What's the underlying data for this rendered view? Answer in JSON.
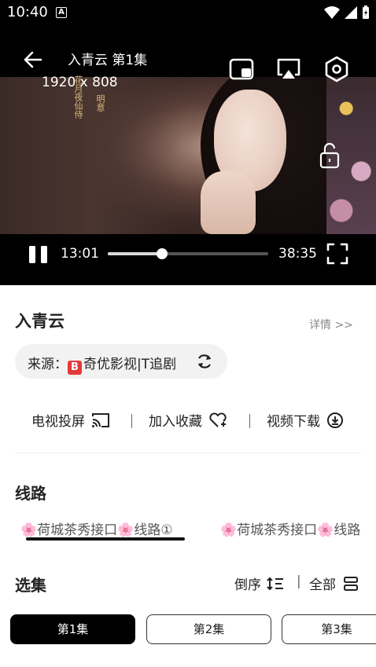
{
  "status_bar": {
    "time": "10:40",
    "a_badge": "A"
  },
  "player": {
    "title": "入青云 第1集",
    "resolution": "1920 x 808",
    "poem_col1": "花月夜仙侍",
    "poem_col2": "明意",
    "current_time": "13:01",
    "total_time": "38:35",
    "progress": 0.3375
  },
  "show": {
    "title": "入青云",
    "details_label": "详情 >>",
    "source_label": "来源：",
    "source_badge": "B",
    "source_name": "奇优影视|T追剧"
  },
  "actions": {
    "tv_cast": "电视投屏",
    "sep1": "|",
    "favorite": "加入收藏",
    "sep2": "|",
    "download": "视频下载"
  },
  "routes": {
    "title": "线路",
    "items": [
      "🌸荷城茶秀接口🌸线路①",
      "🌸荷城茶秀接口🌸线路"
    ]
  },
  "episodes": {
    "title": "选集",
    "reverse_label": "倒序",
    "sep": "|",
    "all_label": "全部",
    "items": [
      "第1集",
      "第2集",
      "第3集"
    ]
  },
  "colors": {
    "accent_badge": "#e23a3a",
    "active_episode_bg": "#000000"
  }
}
